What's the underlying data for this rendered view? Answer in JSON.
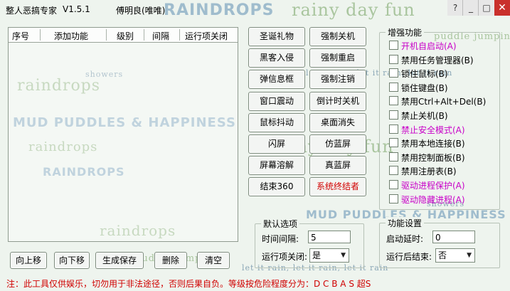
{
  "window": {
    "title": "整人恶搞专家",
    "version": "V1.5.1",
    "author": "傅明良(唯唯)"
  },
  "titlebar_buttons": {
    "help": "?",
    "minimize": "_",
    "maximize": "□",
    "close": "✕"
  },
  "wallpaper": {
    "texts": [
      "RAINDROPS",
      "rainy day fun",
      "puddle jumpin'",
      "raindrops",
      "let it rain, let it rain, let it rain",
      "MUD PUDDLES & HAPPINESS",
      "showers",
      "raindrops",
      "rainy day fun",
      "RAINDROPS",
      "MUD PUDDLES & HAPPINESS",
      "let it rain, let it rain, let it rain",
      "puddle jumpin'",
      "raindrops",
      "showers"
    ]
  },
  "list": {
    "columns": [
      "序号",
      "添加功能",
      "级别",
      "间隔",
      "运行项关闭"
    ],
    "rows": []
  },
  "actions": [
    [
      "圣诞礼物",
      "强制关机"
    ],
    [
      "黑客入侵",
      "强制重启"
    ],
    [
      "弹信息框",
      "强制注销"
    ],
    [
      "窗口震动",
      "倒计时关机"
    ],
    [
      "鼠标抖动",
      "桌面消失"
    ],
    [
      "闪屏",
      "仿蓝屏"
    ],
    [
      "屏幕溶解",
      "真蓝屏"
    ],
    [
      "结束360",
      "系统终结者"
    ]
  ],
  "enhance": {
    "title": "增强功能",
    "items": [
      {
        "label": "开机自启动(A)",
        "highlight": true
      },
      {
        "label": "禁用任务管理器(B)",
        "highlight": false
      },
      {
        "label": "锁住鼠标(B)",
        "highlight": false
      },
      {
        "label": "锁住键盘(B)",
        "highlight": false
      },
      {
        "label": "禁用Ctrl+Alt+Del(B)",
        "highlight": false
      },
      {
        "label": "禁止关机(B)",
        "highlight": false
      },
      {
        "label": "禁止安全模式(A)",
        "highlight": true
      },
      {
        "label": "禁用本地连接(B)",
        "highlight": false
      },
      {
        "label": "禁用控制面板(B)",
        "highlight": false
      },
      {
        "label": "禁用注册表(B)",
        "highlight": false
      },
      {
        "label": "驱动进程保护(A)",
        "highlight": true
      },
      {
        "label": "驱动隐藏进程(A)",
        "highlight": true
      }
    ]
  },
  "defaults": {
    "title": "默认选项",
    "interval_label": "时间间隔:",
    "interval_value": "5",
    "close_label": "运行项关闭:",
    "close_value": "是"
  },
  "settings": {
    "title": "功能设置",
    "delay_label": "启动延时:",
    "delay_value": "0",
    "after_label": "运行后结束:",
    "after_value": "否"
  },
  "bottom_buttons": [
    "向上移",
    "向下移",
    "生成保存",
    "删除",
    "清空"
  ],
  "footer": "注：此工具仅供娱乐，切勿用于非法途径，否则后果自负。等级按危险程度分为：D C B A S 超S",
  "colors": {
    "accent_red": "#d10000",
    "highlight_magenta": "#c800c8",
    "background": "#eef4ee"
  }
}
